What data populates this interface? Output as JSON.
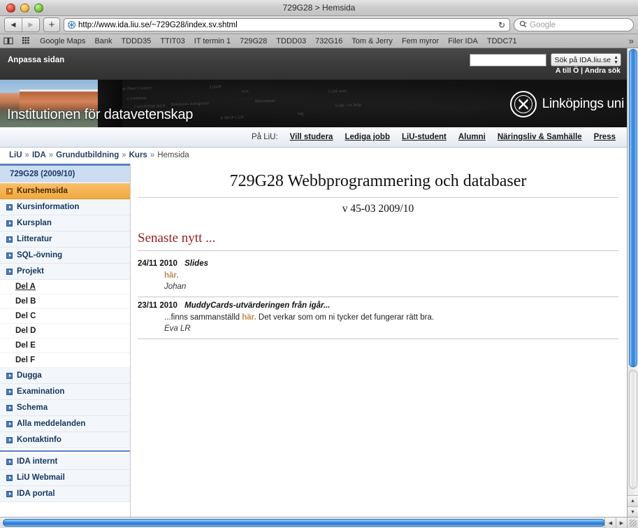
{
  "window": {
    "title": "729G28 > Hemsida"
  },
  "toolbar": {
    "back_label": "◀",
    "forward_label": "▶",
    "add_label": "+",
    "url": "http://www.ida.liu.se/~729G28/index.sv.shtml",
    "reload_label": "↻",
    "search_placeholder": "Google"
  },
  "bookmarks": {
    "items": [
      "Google Maps",
      "Bank",
      "TDDD35",
      "TTIT03",
      "IT termin 1",
      "729G28",
      "TDDD03",
      "732G16",
      "Tom & Jerry",
      "Fem myror",
      "Filer IDA",
      "TDDC71"
    ],
    "overflow_label": "»"
  },
  "utility_bar": {
    "customize_label": "Anpassa sidan",
    "search_value": "",
    "search_scope": "Sök på IDA.liu.se",
    "links": "A till Ö | Andra sök"
  },
  "banner": {
    "department_title": "Institutionen för datavetenskap",
    "university_wordmark": "Linköpings uni",
    "chalk_notes": [
      "The Dust Counter",
      "LOOP",
      "non",
      "a common",
      "Solutions kategorier",
      "COUNTER BUS",
      "CONSISTOR",
      "Movement",
      "Cold start",
      "A MCP CUP",
      "Link / sv help",
      "tag"
    ]
  },
  "topnav": {
    "lead": "På LiU:",
    "items": [
      "Vill studera",
      "Lediga jobb",
      "LiU-student",
      "Alumni",
      "Näringsliv & Samhälle",
      "Press"
    ]
  },
  "breadcrumb": {
    "items": [
      "LiU",
      "IDA",
      "Grundutbildning",
      "Kurs",
      "Hemsida"
    ],
    "separator": "»"
  },
  "sidebar": {
    "header": "729G28 (2009/10)",
    "items": [
      {
        "label": "Kurshemsida",
        "active": true,
        "type": "top"
      },
      {
        "label": "Kursinformation",
        "active": false,
        "type": "top"
      },
      {
        "label": "Kursplan",
        "active": false,
        "type": "top"
      },
      {
        "label": "Litteratur",
        "active": false,
        "type": "top"
      },
      {
        "label": "SQL-övning",
        "active": false,
        "type": "top"
      },
      {
        "label": "Projekt",
        "active": false,
        "type": "top"
      },
      {
        "label": "Del A",
        "active": false,
        "type": "sub",
        "current": true
      },
      {
        "label": "Del B",
        "active": false,
        "type": "sub"
      },
      {
        "label": "Del C",
        "active": false,
        "type": "sub"
      },
      {
        "label": "Del D",
        "active": false,
        "type": "sub"
      },
      {
        "label": "Del E",
        "active": false,
        "type": "sub"
      },
      {
        "label": "Del F",
        "active": false,
        "type": "sub"
      },
      {
        "label": "Dugga",
        "active": false,
        "type": "top"
      },
      {
        "label": "Examination",
        "active": false,
        "type": "top"
      },
      {
        "label": "Schema",
        "active": false,
        "type": "top"
      },
      {
        "label": "Alla meddelanden",
        "active": false,
        "type": "top"
      },
      {
        "label": "Kontaktinfo",
        "active": false,
        "type": "top"
      },
      {
        "label": "IDA internt",
        "active": false,
        "type": "top",
        "group_start": true
      },
      {
        "label": "LiU Webmail",
        "active": false,
        "type": "top"
      },
      {
        "label": "IDA portal",
        "active": false,
        "type": "top"
      }
    ]
  },
  "main": {
    "course_title": "729G28 Webbprogrammering och databaser",
    "course_subtitle": "v 45-03 2009/10",
    "news_heading": "Senaste nytt ...",
    "news": [
      {
        "date": "24/11 2010",
        "subject": "Slides",
        "body_before": "",
        "link": "här.",
        "body_after": "",
        "signature": "Johan"
      },
      {
        "date": "23/11 2010",
        "subject": "MuddyCards-utvärderingen från igår...",
        "body_before": "...finns sammanställd ",
        "link": "här.",
        "body_after": " Det verkar som om ni tycker det fungerar rätt bra.",
        "signature": "Eva LR"
      }
    ]
  },
  "scrollbars": {
    "up_arrow": "▲",
    "down_arrow": "▼",
    "left_arrow": "◀",
    "right_arrow": "▶"
  },
  "colors": {
    "accent_blue": "#3f93e8",
    "active_orange": "#f0a93f",
    "news_red": "#9b1b1b",
    "link_tan": "#c08b54"
  }
}
